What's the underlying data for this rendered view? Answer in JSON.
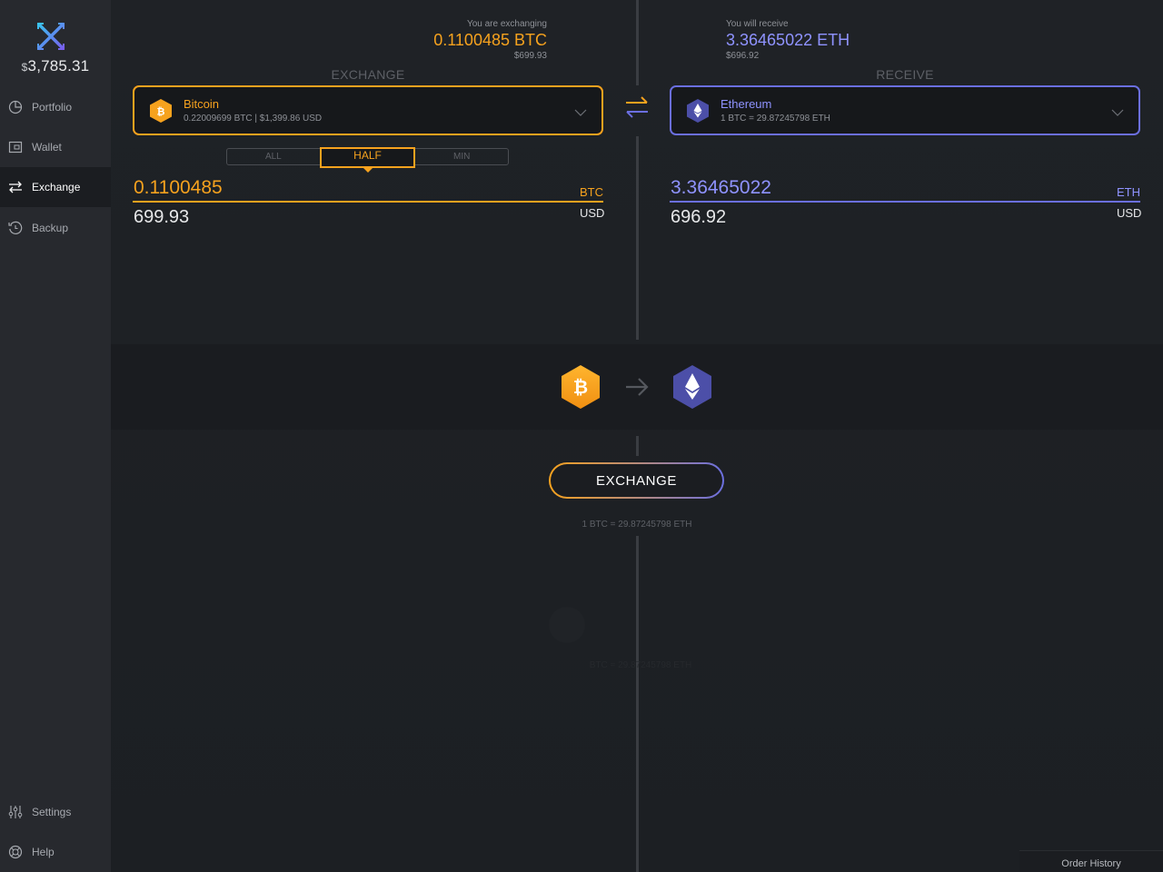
{
  "sidebar": {
    "balance_currency": "$",
    "balance": "3,785.31",
    "items": [
      {
        "label": "Portfolio",
        "icon": "pie-chart-icon"
      },
      {
        "label": "Wallet",
        "icon": "wallet-icon"
      },
      {
        "label": "Exchange",
        "icon": "exchange-arrows-icon"
      },
      {
        "label": "Backup",
        "icon": "backup-icon"
      },
      {
        "label": "Settings",
        "icon": "sliders-icon"
      },
      {
        "label": "Help",
        "icon": "lifebuoy-icon"
      }
    ]
  },
  "exchange_side": {
    "title": "EXCHANGE",
    "coin_name": "Bitcoin",
    "coin_sub": "0.22009699 BTC  |  $1,399.86 USD",
    "amount": "0.1100485",
    "unit": "BTC",
    "usd_amount": "699.93",
    "usd_unit": "USD",
    "toggle_options": [
      "ALL",
      "HALF",
      "MIN"
    ],
    "toggle_selected": "HALF"
  },
  "receive_side": {
    "title": "RECEIVE",
    "coin_name": "Ethereum",
    "coin_sub": "1 BTC  =  29.87245798 ETH",
    "amount": "3.36465022",
    "unit": "ETH",
    "usd_amount": "696.92",
    "usd_unit": "USD"
  },
  "summary": {
    "left_label": "You are exchanging",
    "left_amount": "0.1100485 BTC",
    "left_usd": "$699.93",
    "right_label": "You will receive",
    "right_amount": "3.36465022 ETH",
    "right_usd": "$696.92"
  },
  "exchange_button": "EXCHANGE",
  "rate_text": "1 BTC = 29.87245798 ETH",
  "ghost_rate_text": "BTC = 29.87245798 ETH",
  "order_history": "Order History",
  "colors": {
    "btc": "#f6a21e",
    "eth": "#6b6fe0",
    "background": "#1d2024",
    "sidebar": "#27292e"
  }
}
